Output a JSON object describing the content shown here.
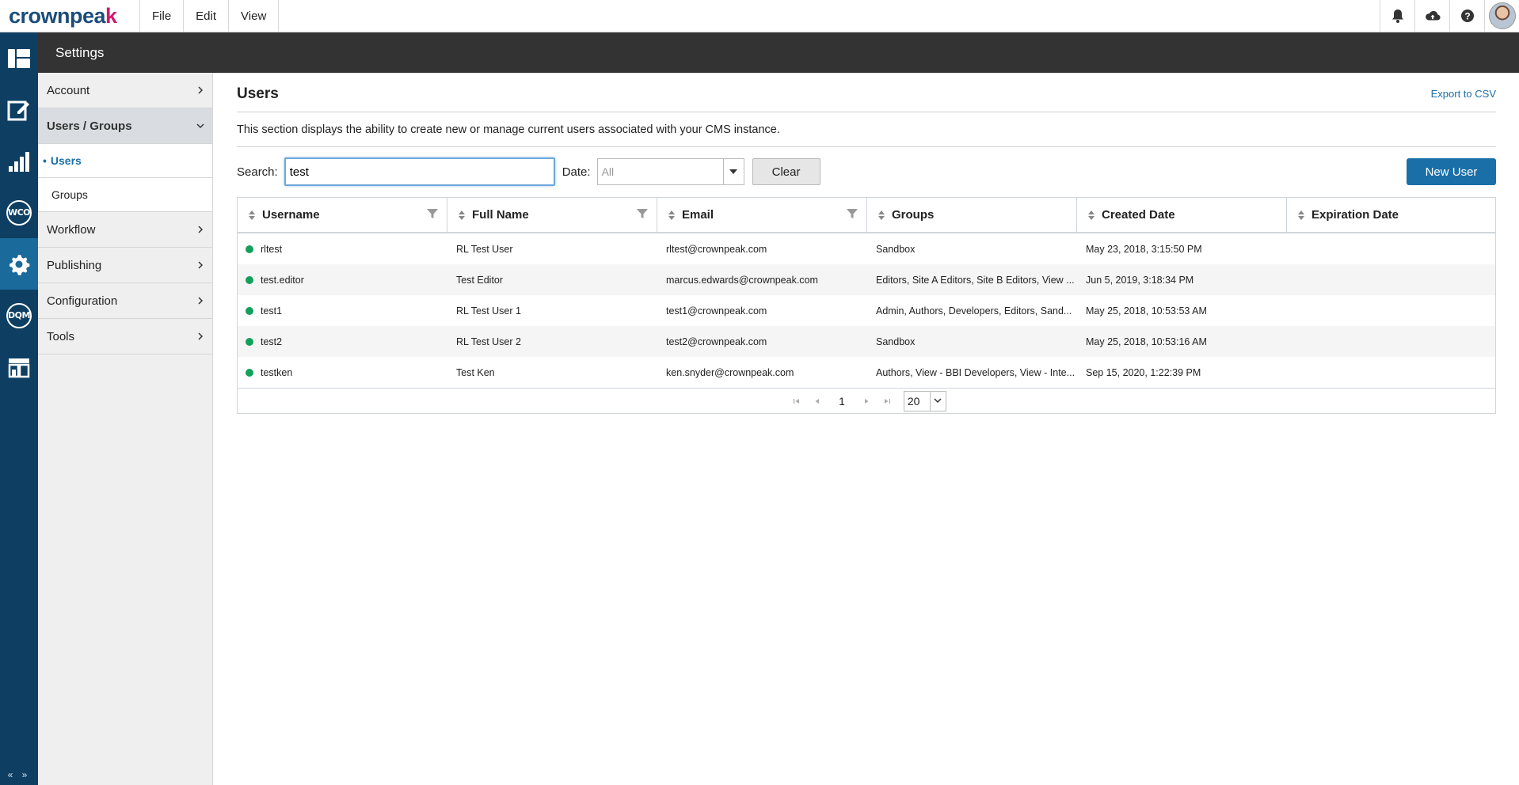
{
  "app": {
    "logo_text": "crownpeak",
    "logo_main": "crownpea",
    "logo_accent": "k"
  },
  "menu": {
    "file": "File",
    "edit": "Edit",
    "view": "View"
  },
  "top_icons": [
    "bell-icon",
    "cloud-upload-icon",
    "help-icon",
    "user-avatar"
  ],
  "rail": {
    "wco": "WCO",
    "dqm": "DQM",
    "collapse": "« »"
  },
  "band": {
    "title": "Settings"
  },
  "nav": {
    "account": "Account",
    "users_groups": "Users / Groups",
    "users": "Users",
    "groups": "Groups",
    "workflow": "Workflow",
    "publishing": "Publishing",
    "configuration": "Configuration",
    "tools": "Tools"
  },
  "page": {
    "title": "Users",
    "export": "Export to CSV",
    "description": "This section displays the ability to create new or manage current users associated with your CMS instance."
  },
  "toolbar": {
    "search_label": "Search:",
    "search_value": "test",
    "date_label": "Date:",
    "date_value": "All",
    "clear": "Clear",
    "new_user": "New User"
  },
  "table": {
    "columns": [
      "Username",
      "Full Name",
      "Email",
      "Groups",
      "Created Date",
      "Expiration Date"
    ],
    "rows": [
      {
        "username": "rltest",
        "full_name": "RL Test User",
        "email": "rltest@crownpeak.com",
        "groups": "Sandbox",
        "created": "May 23, 2018, 3:15:50 PM",
        "expiration": ""
      },
      {
        "username": "test.editor",
        "full_name": "Test Editor",
        "email": "marcus.edwards@crownpeak.com",
        "groups": "Editors, Site A Editors, Site B Editors, View ...",
        "created": "Jun 5, 2019, 3:18:34 PM",
        "expiration": ""
      },
      {
        "username": "test1",
        "full_name": "RL Test User 1",
        "email": "test1@crownpeak.com",
        "groups": "Admin, Authors, Developers, Editors, Sand...",
        "created": "May 25, 2018, 10:53:53 AM",
        "expiration": ""
      },
      {
        "username": "test2",
        "full_name": "RL Test User 2",
        "email": "test2@crownpeak.com",
        "groups": "Sandbox",
        "created": "May 25, 2018, 10:53:16 AM",
        "expiration": ""
      },
      {
        "username": "testken",
        "full_name": "Test Ken",
        "email": "ken.snyder@crownpeak.com",
        "groups": "Authors, View - BBI Developers, View - Inte...",
        "created": "Sep 15, 2020, 1:22:39 PM",
        "expiration": ""
      }
    ]
  },
  "pager": {
    "page": "1",
    "page_size": "20"
  },
  "colors": {
    "accent": "#1a6fa8",
    "rail": "#0e3f63",
    "band": "#333333",
    "status_active": "#13a05b"
  }
}
